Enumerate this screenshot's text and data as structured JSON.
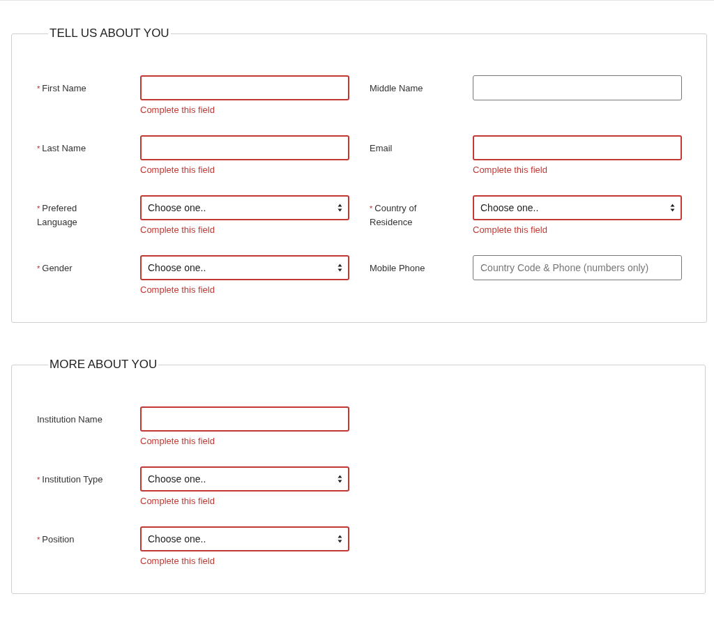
{
  "sections": [
    {
      "title": "TELL US ABOUT YOU",
      "rows": [
        [
          {
            "label": "First Name",
            "required_mark": "*",
            "kind": "text",
            "invalid": true,
            "error": "Complete this field"
          },
          {
            "label": "Middle Name",
            "kind": "text",
            "invalid": false
          }
        ],
        [
          {
            "label": "Last Name",
            "required_mark": "*",
            "kind": "text",
            "invalid": true,
            "error": "Complete this field"
          },
          {
            "label": "Email",
            "kind": "text",
            "invalid": true,
            "error": "Complete this field"
          }
        ],
        [
          {
            "label": "Prefered Language",
            "required_mark": "*",
            "kind": "select",
            "value": "Choose one..",
            "invalid": true,
            "error": "Complete this field"
          },
          {
            "label": "Country of Residence",
            "required_mark": "*",
            "kind": "select",
            "value": "Choose one..",
            "invalid": true,
            "error": "Complete this field"
          }
        ],
        [
          {
            "label": "Gender",
            "required_mark": "*",
            "kind": "select",
            "value": "Choose one..",
            "invalid": true,
            "error": "Complete this field"
          },
          {
            "label": "Mobile Phone",
            "kind": "text",
            "placeholder": "Country Code & Phone (numbers only)",
            "invalid": false
          }
        ]
      ]
    },
    {
      "title": "MORE ABOUT YOU",
      "rows": [
        [
          {
            "label": "Institution Name",
            "kind": "text",
            "invalid": true,
            "error": "Complete this field"
          }
        ],
        [
          {
            "label": "Institution Type",
            "required_mark": "*",
            "kind": "select",
            "value": "Choose one..",
            "invalid": true,
            "error": "Complete this field"
          }
        ],
        [
          {
            "label": "Position",
            "required_mark": "*",
            "kind": "select",
            "value": "Choose one..",
            "invalid": true,
            "error": "Complete this field"
          }
        ]
      ]
    }
  ]
}
